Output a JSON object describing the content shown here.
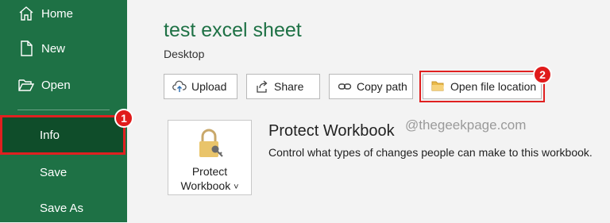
{
  "sidebar": {
    "items": [
      {
        "label": "Home",
        "icon": "home-icon"
      },
      {
        "label": "New",
        "icon": "new-file-icon"
      },
      {
        "label": "Open",
        "icon": "folder-open-icon"
      },
      {
        "label": "Info"
      },
      {
        "label": "Save"
      },
      {
        "label": "Save As"
      }
    ]
  },
  "document": {
    "title": "test excel sheet",
    "location": "Desktop"
  },
  "actions": {
    "upload": "Upload",
    "share": "Share",
    "copy_path": "Copy path",
    "open_location": "Open file location"
  },
  "protect": {
    "button_line1": "Protect",
    "button_line2": "Workbook",
    "chevron": "˅",
    "heading": "Protect Workbook",
    "description": "Control what types of changes people can make to this workbook."
  },
  "annotations": {
    "badge1": "1",
    "badge2": "2",
    "watermark": "@thegeekpage.com"
  },
  "colors": {
    "sidebar_bg": "#1e7145",
    "selected_bg": "#0f4d2a",
    "highlight_red": "#e02020",
    "title_green": "#1e7145"
  }
}
